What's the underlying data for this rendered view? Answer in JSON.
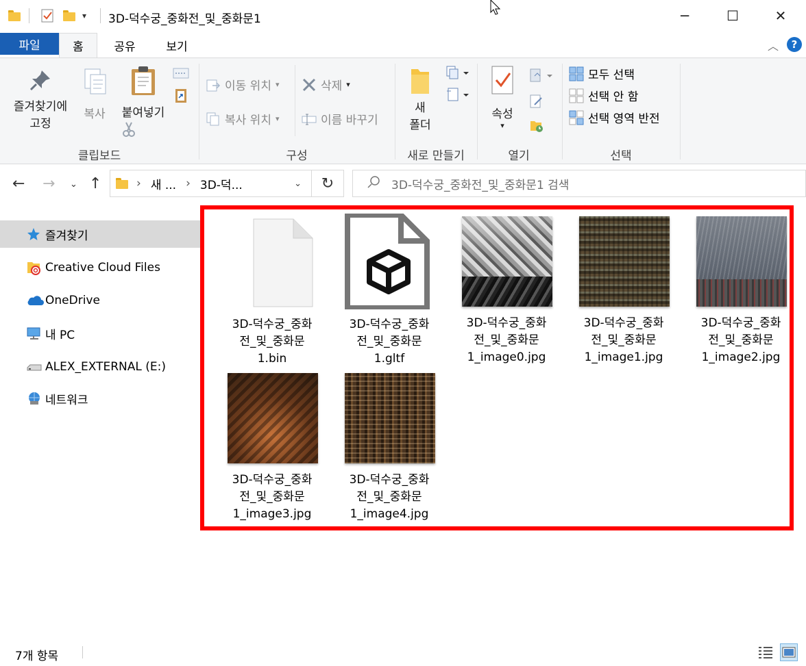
{
  "window": {
    "title": "3D-덕수궁_중화전_및_중화문1",
    "minimize": "─",
    "maximize": "☐",
    "close": "✕"
  },
  "tabs": [
    {
      "label": "파일"
    },
    {
      "label": "홈"
    },
    {
      "label": "공유"
    },
    {
      "label": "보기"
    }
  ],
  "ribbon": {
    "clipboard": {
      "label": "클립보드",
      "pin_line1": "즐겨찾기에",
      "pin_line2": "고정",
      "copy": "복사",
      "paste": "붙여넣기"
    },
    "organize": {
      "label": "구성",
      "move_to": "이동 위치",
      "copy_to": "복사 위치",
      "delete": "삭제",
      "rename": "이름 바꾸기"
    },
    "new": {
      "label": "새로 만들기",
      "new_folder_line1": "새",
      "new_folder_line2": "폴더"
    },
    "open": {
      "label": "열기",
      "properties": "속성"
    },
    "select": {
      "label": "선택",
      "select_all": "모두 선택",
      "select_none": "선택 안 함",
      "invert": "선택 영역 반전"
    }
  },
  "address": {
    "crumb1": "새 ...",
    "crumb2": "3D-덕...",
    "search_placeholder": "3D-덕수궁_중화전_및_중화문1 검색"
  },
  "nav": [
    {
      "label": "즐겨찾기",
      "icon": "star-icon"
    },
    {
      "label": "Creative Cloud Files",
      "icon": "creative-cloud-folder-icon"
    },
    {
      "label": "OneDrive",
      "icon": "cloud-icon"
    },
    {
      "label": "내 PC",
      "icon": "computer-icon"
    },
    {
      "label": "ALEX_EXTERNAL (E:)",
      "icon": "drive-icon"
    },
    {
      "label": "네트워크",
      "icon": "network-icon"
    }
  ],
  "files": [
    {
      "line1": "3D-덕수궁_중화",
      "line2": "전_및_중화문",
      "line3": "1.bin",
      "kind": "generic"
    },
    {
      "line1": "3D-덕수궁_중화",
      "line2": "전_및_중화문",
      "line3": "1.gltf",
      "kind": "gltf"
    },
    {
      "line1": "3D-덕수궁_중화",
      "line2": "전_및_중화문",
      "line3": "1_image0.jpg",
      "kind": "image"
    },
    {
      "line1": "3D-덕수궁_중화",
      "line2": "전_및_중화문",
      "line3": "1_image1.jpg",
      "kind": "image"
    },
    {
      "line1": "3D-덕수궁_중화",
      "line2": "전_및_중화문",
      "line3": "1_image2.jpg",
      "kind": "image"
    },
    {
      "line1": "3D-덕수궁_중화",
      "line2": "전_및_중화문",
      "line3": "1_image3.jpg",
      "kind": "image"
    },
    {
      "line1": "3D-덕수궁_중화",
      "line2": "전_및_중화문",
      "line3": "1_image4.jpg",
      "kind": "image"
    }
  ],
  "status": {
    "item_count": "7개 항목"
  },
  "colors": {
    "accent": "#1a5fb4",
    "highlight": "#ff0000",
    "folder": "#f6c443"
  }
}
